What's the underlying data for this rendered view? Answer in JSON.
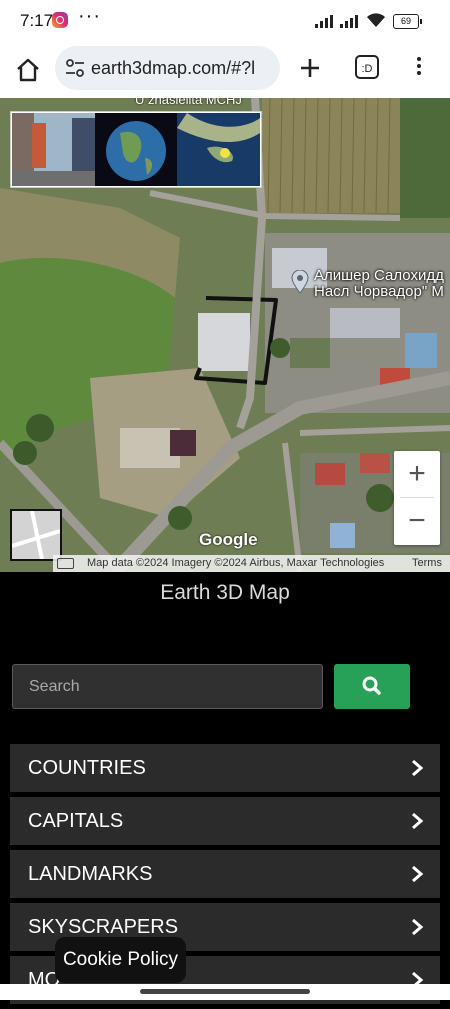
{
  "status_bar": {
    "time": "7:17",
    "more": "···",
    "battery": "69"
  },
  "browser": {
    "url": "earth3dmap.com/#?l",
    "tabs_count": ":D"
  },
  "map": {
    "top_label": "U znasiellta MCHJ",
    "place_label": "Алишер Салохидд\nНасл Чорвадор\" М",
    "google": "Google",
    "attribution": "Map data ©2024 Imagery ©2024 Airbus, Maxar Technologies",
    "terms": "Terms",
    "zoom_in": "+",
    "zoom_out": "−"
  },
  "site": {
    "title": "Earth 3D Map",
    "search_placeholder": "Search",
    "menu": [
      "COUNTRIES",
      "CAPITALS",
      "LANDMARKS",
      "SKYSCRAPERS",
      "MO"
    ]
  },
  "cookie": "Cookie Policy",
  "colors": {
    "search_button": "#27a158",
    "menu_row": "#2b2b2b"
  }
}
